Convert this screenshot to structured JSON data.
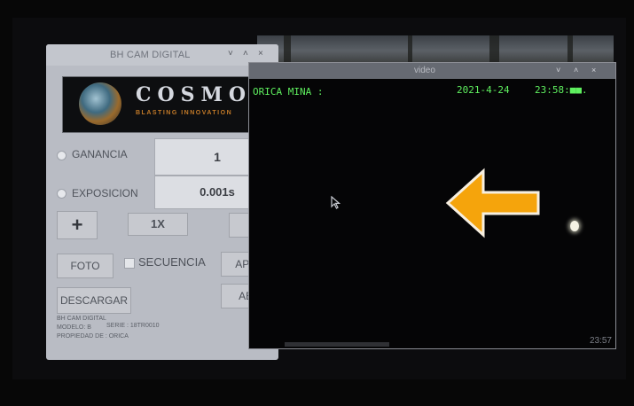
{
  "camera_window": {
    "title": "BH CAM DIGITAL",
    "controls": {
      "minimize": "˅",
      "maximize": "˄",
      "close": "×"
    },
    "logo": {
      "name": "COSMOS",
      "tagline": "BLASTING INNOVATION"
    },
    "gain": {
      "label": "GANANCIA",
      "value": "1"
    },
    "exposure": {
      "label": "EXPOSICION",
      "value": "0.001s"
    },
    "zoom": {
      "plus": "+",
      "value": "1X",
      "minus": "−"
    },
    "photo_button": "FOTO",
    "sequence_label": "SECUENCIA",
    "off_button": "APAG",
    "download_button": "DESCARGAR",
    "open_button": "ABC",
    "info": {
      "line1": "BH CAM DIGITAL",
      "line2a": "MODELO: B",
      "line2b": "SERIE : 18TR0010",
      "line3": "PROPIEDAD DE : ORICA"
    }
  },
  "video_window": {
    "title": "video",
    "controls": {
      "minimize": "˅",
      "maximize": "˄",
      "close": "×"
    },
    "osd_left": "ORICA   MINA :",
    "osd_date": "2021-4-24",
    "osd_time": "23:58:■■.",
    "clock": "23:57"
  },
  "colors": {
    "arrow": "#f5a40c",
    "osd_text": "#5ff05f",
    "logo_tagline": "#c37a28"
  },
  "icons": [
    "mouse-pointer-icon",
    "orange-left-arrow-icon",
    "cosmos-globe-logo"
  ]
}
